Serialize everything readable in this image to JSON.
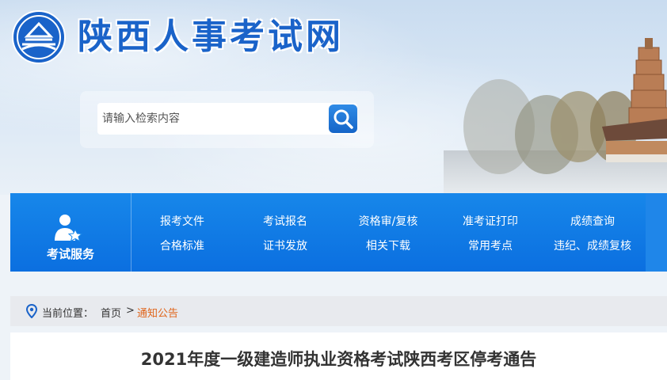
{
  "header": {
    "site_title": "陕西人事考试网",
    "search_placeholder": "请输入检索内容"
  },
  "service": {
    "title": "考试服务",
    "links_row1": [
      "报考文件",
      "考试报名",
      "资格审/复核",
      "准考证打印",
      "成绩查询"
    ],
    "links_row2": [
      "合格标准",
      "证书发放",
      "相关下载",
      "常用考点",
      "违纪、成绩复核"
    ]
  },
  "breadcrumb": {
    "prefix": "当前位置：",
    "home": "首页",
    "separator": ">",
    "current": "通知公告"
  },
  "article": {
    "title": "2021年度一级建造师执业资格考试陕西考区停考通告"
  },
  "colors": {
    "brand_blue": "#1a63c9",
    "service_bar": "#1787ea",
    "breadcrumb_current": "#e0651b"
  }
}
